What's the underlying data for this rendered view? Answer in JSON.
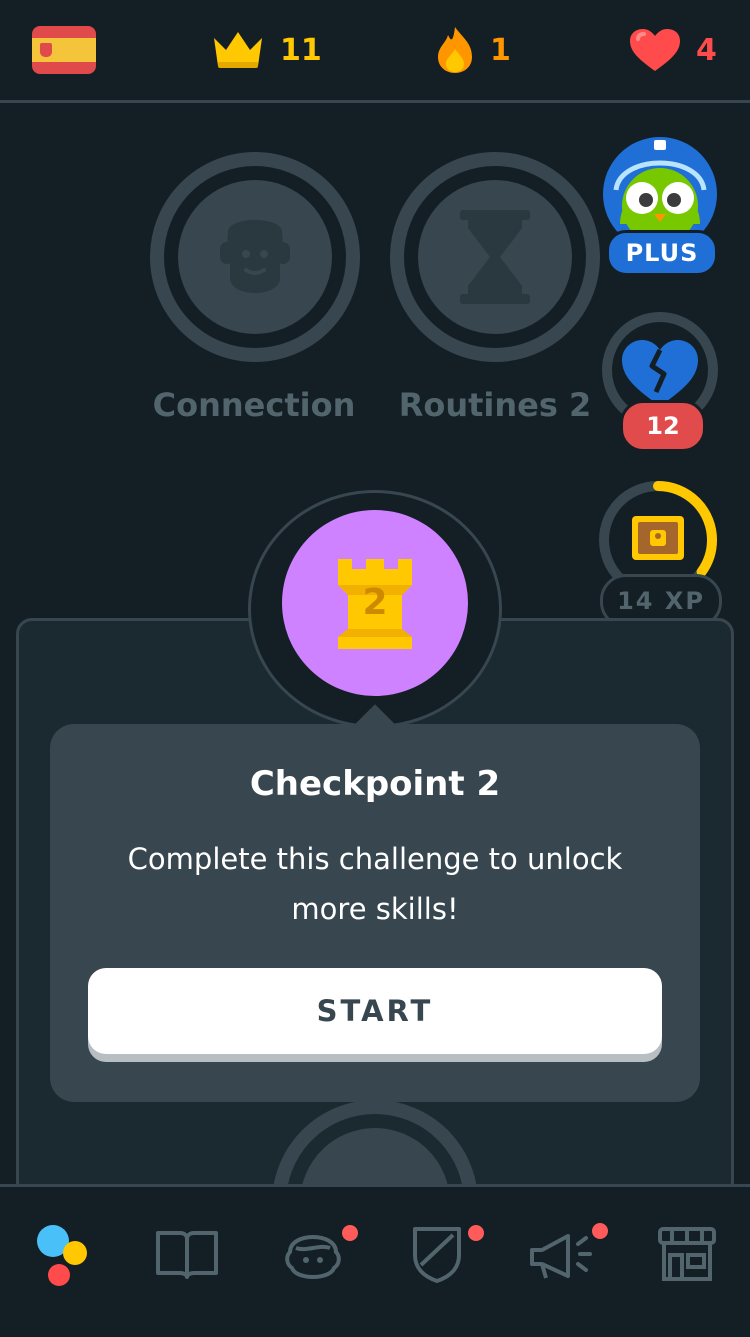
{
  "header": {
    "flag_icon": "spain-flag-icon",
    "crowns": "11",
    "streak": "1",
    "hearts": "4",
    "colors": {
      "crown": "#ffc800",
      "streak": "#ff9600",
      "heart": "#ff4b4b"
    }
  },
  "skills": [
    {
      "label": "Connection",
      "icon": "person-face-icon"
    },
    {
      "label": "Routines 2",
      "icon": "hourglass-icon"
    }
  ],
  "side": {
    "plus_label": "PLUS",
    "hearts_refill_count": "12",
    "xp_label": "14 XP",
    "xp_progress_fraction": 0.35
  },
  "checkpoint": {
    "number": "2",
    "title": "Checkpoint 2",
    "description": "Complete this challenge to unlock more skills!",
    "start_label": "START",
    "color": "#ce82ff"
  },
  "nav": [
    {
      "name": "learn",
      "icon": "learn-dots-icon",
      "notification": false
    },
    {
      "name": "stories",
      "icon": "book-icon",
      "notification": false
    },
    {
      "name": "profile",
      "icon": "profile-icon",
      "notification": true
    },
    {
      "name": "leaderboard",
      "icon": "shield-icon",
      "notification": true
    },
    {
      "name": "news",
      "icon": "megaphone-icon",
      "notification": true
    },
    {
      "name": "shop",
      "icon": "shop-icon",
      "notification": false
    }
  ]
}
